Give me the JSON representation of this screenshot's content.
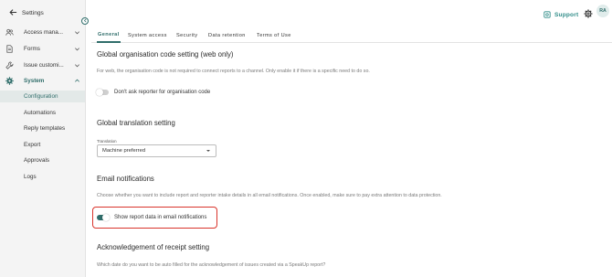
{
  "sidebar": {
    "title": "Settings",
    "items": [
      {
        "label": "Access mana..."
      },
      {
        "label": "Forms"
      },
      {
        "label": "Issue customi..."
      },
      {
        "label": "System"
      }
    ],
    "sub_items": [
      {
        "label": "Configuration"
      },
      {
        "label": "Automations"
      },
      {
        "label": "Reply templates"
      },
      {
        "label": "Export"
      },
      {
        "label": "Approvals"
      },
      {
        "label": "Logs"
      }
    ]
  },
  "topbar": {
    "support_label": "Support",
    "avatar_initials": "RA"
  },
  "tabs": [
    {
      "label": "General"
    },
    {
      "label": "System access"
    },
    {
      "label": "Security"
    },
    {
      "label": "Data retention"
    },
    {
      "label": "Terms of Use"
    }
  ],
  "sections": {
    "org_code": {
      "title": "Global organisation code setting (web only)",
      "description": "For web, the organisation code is not required to connect reports to a channel. Only enable it if there is a specific need to do so.",
      "toggle_label": "Don't ask reporter for organisation code",
      "toggle_on": false
    },
    "translation": {
      "title": "Global translation setting",
      "field_label": "Translation",
      "select_value": "Machine preferred"
    },
    "email": {
      "title": "Email notifications",
      "description": "Choose whether you want to include report and reporter intake details in all email notifications. Once enabled, make sure to pay extra attention to data protection.",
      "toggle_label": "Show report data in email notifications",
      "toggle_on": true
    },
    "ack": {
      "title": "Acknowledgement of receipt setting",
      "description": "Which date do you want to be auto filled for the acknowledgement of issues created via a SpeakUp report?"
    }
  },
  "colors": {
    "accent": "#2f6d6a",
    "highlight": "#d9342b",
    "sidebar_bg": "#f4f4f4"
  }
}
